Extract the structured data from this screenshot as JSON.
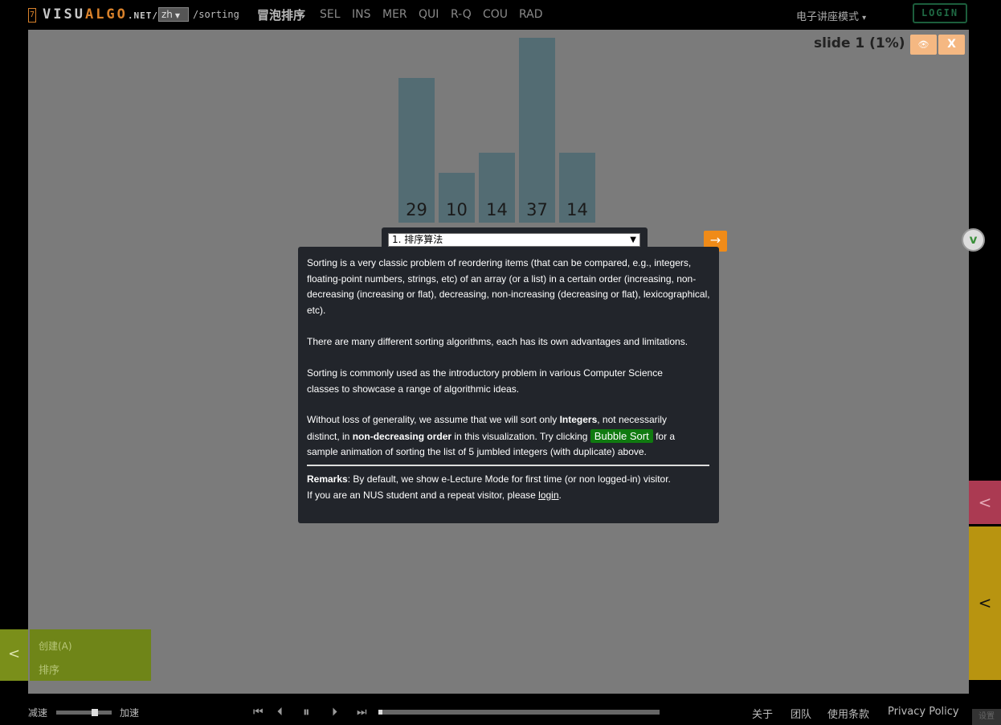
{
  "header": {
    "logo_number": "7",
    "logo_visu": "VISU",
    "logo_algo": "ALGO",
    "logo_net": ".NET",
    "logo_slash": "/",
    "language": "zh",
    "path": "/sorting",
    "algo_title": "冒泡排序",
    "algo_tabs": [
      "SEL",
      "INS",
      "MER",
      "QUI",
      "R-Q",
      "COU",
      "RAD"
    ],
    "mode_label": "电子讲座模式",
    "mode_caret": "▾",
    "login_label": "LOGIN"
  },
  "slide": {
    "label": "slide 1 (1%)",
    "hide_icon": "hide-icon",
    "close_label": "X",
    "select_value": "1. 排序算法",
    "next_icon": "→"
  },
  "chart_data": {
    "type": "bar",
    "values": [
      29,
      10,
      14,
      37,
      14
    ]
  },
  "lecture": {
    "p1": "Sorting is a very classic problem of reordering items (that can be compared, e.g., integers, floating-point numbers, strings, etc) of an array (or a list) in a certain order (increasing, non-decreasing (increasing or flat), decreasing, non-increasing (decreasing or flat), lexicographical, etc).",
    "p2": "There are many different sorting algorithms, each has its own advantages and limitations.",
    "p3": "Sorting is commonly used as the introductory problem in various Computer Science classes to showcase a range of algorithmic ideas.",
    "p4_a": "Without loss of generality, we assume that we will sort only ",
    "p4_b": "Integers",
    "p4_c": ", not necessarily distinct, in ",
    "p4_d": "non-decreasing order",
    "p4_e": " in this visualization. Try clicking ",
    "p4_link": "Bubble Sort",
    "p4_f": " for a sample animation of sorting the list of 5 jumbled integers (with duplicate) above.",
    "remarks_label": "Remarks",
    "remarks_a": ": By default, we show e-Lecture Mode for first time (or non logged-in) visitor.",
    "remarks_b": "If you are an NUS student and a repeat visitor, please ",
    "remarks_login": "login",
    "remarks_end": "."
  },
  "side": {
    "yt_icon": "v",
    "red_chevron": "<",
    "gold_chevron": "<"
  },
  "actions": {
    "toggle": "<",
    "create": "创建(A)",
    "sort": "排序"
  },
  "bottom": {
    "slow": "减速",
    "fast": "加速",
    "speed_level": 0.7,
    "progress": 0.01,
    "links": [
      "关于",
      "团队",
      "使用条款",
      "Privacy Policy"
    ],
    "corner": "设置"
  },
  "colors": {
    "bar": "#536c73",
    "stage": "#7b7b7b",
    "accent_orange": "#f08b18",
    "bubble_link": "#107a10"
  }
}
